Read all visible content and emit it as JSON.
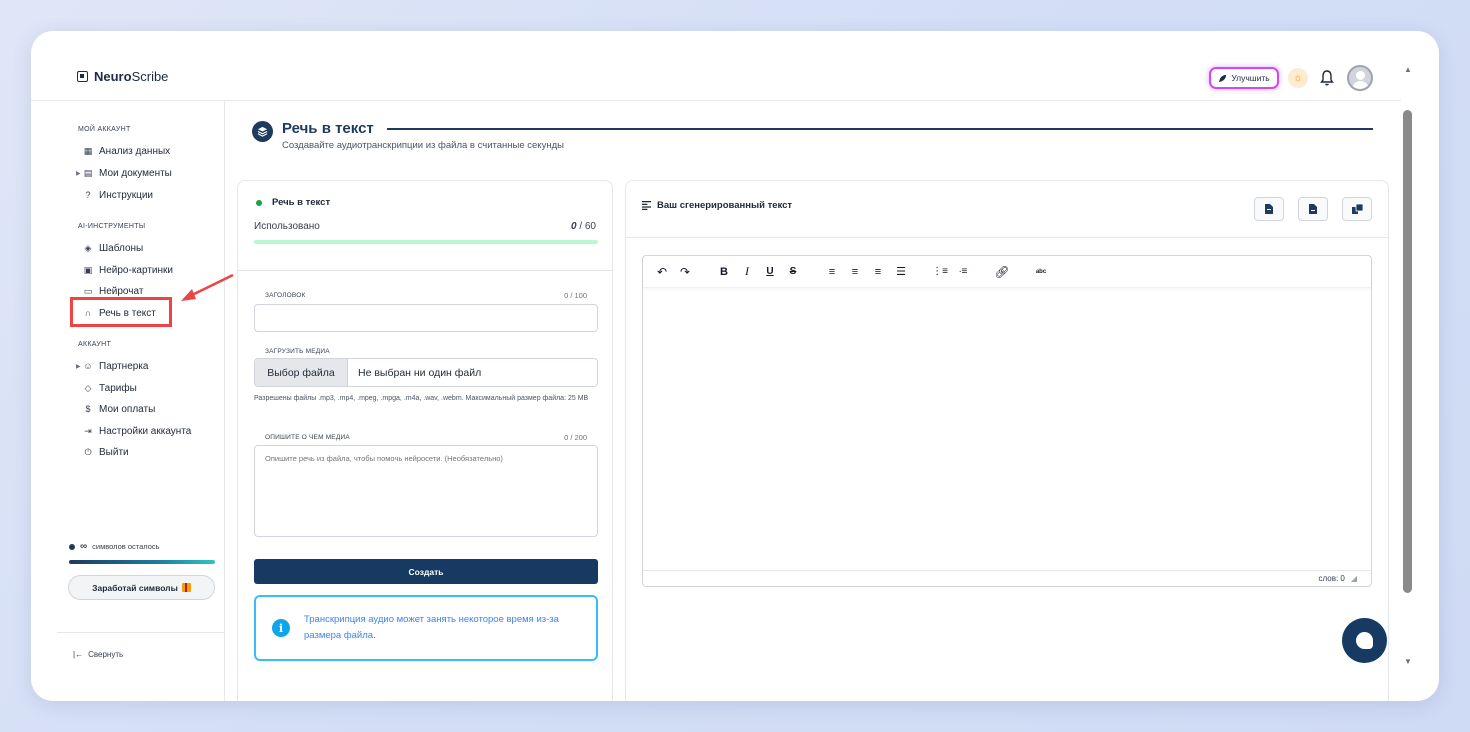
{
  "app": {
    "logo_bold": "Neuro",
    "logo_rest": "Scribe",
    "upgrade_label": "Улучшить"
  },
  "sidebar": {
    "section_account": "МОЙ АККАУНТ",
    "section_ai": "AI-ИНСТРУМЕНТЫ",
    "section_acc2": "АККАУНТ",
    "items": {
      "analytics": "Анализ данных",
      "documents": "Мои документы",
      "instructions": "Инструкции",
      "templates": "Шаблоны",
      "images": "Нейро-картинки",
      "chat": "Нейрочат",
      "speech": "Речь в текст",
      "partner": "Партнерка",
      "plans": "Тарифы",
      "payments": "Мои оплаты",
      "settings": "Настройки аккаунта",
      "logout": "Выйти"
    },
    "credits_symbol": "∞",
    "credits_text": "символов осталось",
    "earn_label": "Заработай символы",
    "collapse_label": "Свернуть"
  },
  "page": {
    "title": "Речь в текст",
    "subtitle": "Создавайте аудиотранскрипции из файла в считанные секунды"
  },
  "form": {
    "panel_title": "Речь в текст",
    "used_label": "Использовано",
    "used_value": "0",
    "used_total": "/ 60",
    "used_fraction": 0,
    "title_label": "ЗАГОЛОВОК",
    "title_count": "0 / 100",
    "title_value": "",
    "media_label": "ЗАГРУЗИТЬ МЕДИА",
    "file_button": "Выбор файла",
    "file_status": "Не выбран ни один файл",
    "file_hint": "Разрешены файлы .mp3, .mp4, .mpeg, .mpga, .m4a, .wav, .webm. Максимальный размер файла: 25 MB",
    "desc_label": "ОПИШИТЕ О ЧЕМ МЕДИА",
    "desc_count": "0 / 200",
    "desc_placeholder": "Опишите речь из файла, чтобы помочь нейросети. (Необязательно)",
    "create_button": "Создать",
    "info_text": "Транскрипция аудио может занять некоторое время из-за размера файла."
  },
  "output": {
    "title": "Ваш сгенерированный текст",
    "word_count": "слов: 0"
  },
  "colors": {
    "primary": "#173a63",
    "accent_green": "#22c55e",
    "info_blue": "#38bdf8",
    "highlight_red": "#ef4444",
    "upgrade_border": "#d946ef"
  }
}
